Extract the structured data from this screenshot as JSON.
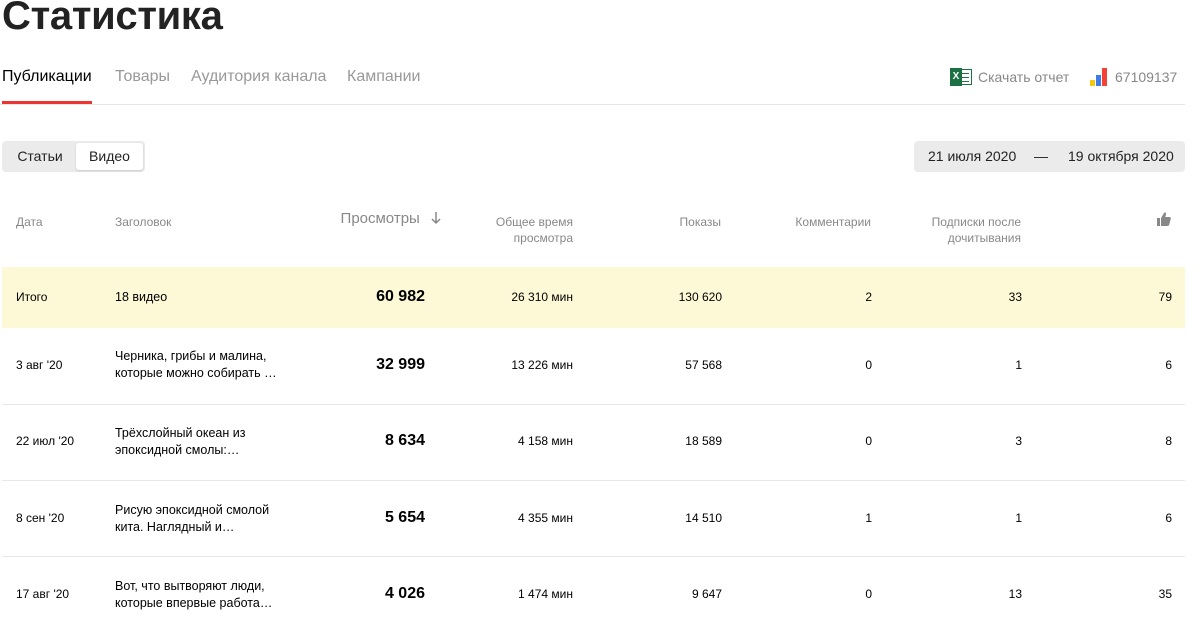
{
  "page": {
    "title": "Статистика"
  },
  "tabs": [
    {
      "label": "Публикации",
      "active": true
    },
    {
      "label": "Товары",
      "active": false
    },
    {
      "label": "Аудитория канала",
      "active": false
    },
    {
      "label": "Кампании",
      "active": false
    }
  ],
  "header_actions": {
    "download_label": "Скачать отчет",
    "download_icon": "excel-icon",
    "account_id": "67109137",
    "account_icon": "metrika-bars-icon"
  },
  "content_type": {
    "options": [
      "Статьи",
      "Видео"
    ],
    "selected": "Видео"
  },
  "date_range": {
    "from": "21 июля 2020",
    "separator": "—",
    "to": "19 октября 2020"
  },
  "table": {
    "columns": {
      "date": "Дата",
      "title": "Заголовок",
      "views": "Просмотры",
      "views_sort_icon": "arrow-down-icon",
      "watch_time_line1": "Общее время",
      "watch_time_line2": "просмотра",
      "shows": "Показы",
      "comments": "Комментарии",
      "subs_line1": "Подписки после",
      "subs_line2": "дочитывания",
      "likes_icon": "thumbs-up-icon"
    },
    "total": {
      "date": "Итого",
      "title": "18 видео",
      "views": "60 982",
      "watch_time": "26 310 мин",
      "shows": "130 620",
      "comments": "2",
      "subs": "33",
      "likes": "79"
    },
    "rows": [
      {
        "date": "3 авг '20",
        "title_line1": "Черника, грибы и малина,",
        "title_line2": "которые можно собирать …",
        "views": "32 999",
        "watch_time": "13 226 мин",
        "shows": "57 568",
        "comments": "0",
        "subs": "1",
        "likes": "6"
      },
      {
        "date": "22 июл '20",
        "title_line1": "Трёхслойный океан из",
        "title_line2": "эпоксидной смолы:…",
        "views": "8 634",
        "watch_time": "4 158 мин",
        "shows": "18 589",
        "comments": "0",
        "subs": "3",
        "likes": "8"
      },
      {
        "date": "8 сен '20",
        "title_line1": "Рисую эпоксидной смолой",
        "title_line2": "кита. Наглядный и…",
        "views": "5 654",
        "watch_time": "4 355 мин",
        "shows": "14 510",
        "comments": "1",
        "subs": "1",
        "likes": "6"
      },
      {
        "date": "17 авг '20",
        "title_line1": "Вот, что вытворяют люди,",
        "title_line2": "которые впервые работа…",
        "views": "4 026",
        "watch_time": "1 474 мин",
        "shows": "9 647",
        "comments": "0",
        "subs": "13",
        "likes": "35"
      }
    ]
  },
  "colors": {
    "active_tab_underline": "#ee3333",
    "total_row_bg": "#fdf8d6",
    "excel_green": "#1d7044"
  }
}
